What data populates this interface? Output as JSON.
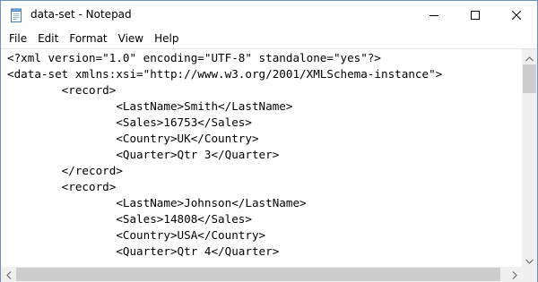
{
  "window": {
    "title": "data-set - Notepad",
    "app_icon": "notepad-icon",
    "controls": {
      "minimize_icon": "minimize-icon",
      "maximize_icon": "maximize-icon",
      "close_icon": "close-icon"
    }
  },
  "menu": {
    "items": [
      {
        "label": "File"
      },
      {
        "label": "Edit"
      },
      {
        "label": "Format"
      },
      {
        "label": "View"
      },
      {
        "label": "Help"
      }
    ]
  },
  "editor": {
    "lines": [
      "<?xml version=\"1.0\" encoding=\"UTF-8\" standalone=\"yes\"?>",
      "<data-set xmlns:xsi=\"http://www.w3.org/2001/XMLSchema-instance\">",
      "\t<record>",
      "\t\t<LastName>Smith</LastName>",
      "\t\t<Sales>16753</Sales>",
      "\t\t<Country>UK</Country>",
      "\t\t<Quarter>Qtr 3</Quarter>",
      "\t</record>",
      "\t<record>",
      "\t\t<LastName>Johnson</LastName>",
      "\t\t<Sales>14808</Sales>",
      "\t\t<Country>USA</Country>",
      "\t\t<Quarter>Qtr 4</Quarter>"
    ]
  },
  "scrollbars": {
    "vertical": {
      "up_icon": "scroll-up-arrow-icon",
      "down_icon": "scroll-down-arrow-icon"
    },
    "horizontal": {
      "left_icon": "scroll-left-arrow-icon",
      "right_icon": "scroll-right-arrow-icon"
    }
  },
  "colors": {
    "window_border": "#6e8fbf",
    "scrollbar_track": "#f0f0f0",
    "scrollbar_thumb": "#cdcdcd",
    "text": "#000000"
  }
}
